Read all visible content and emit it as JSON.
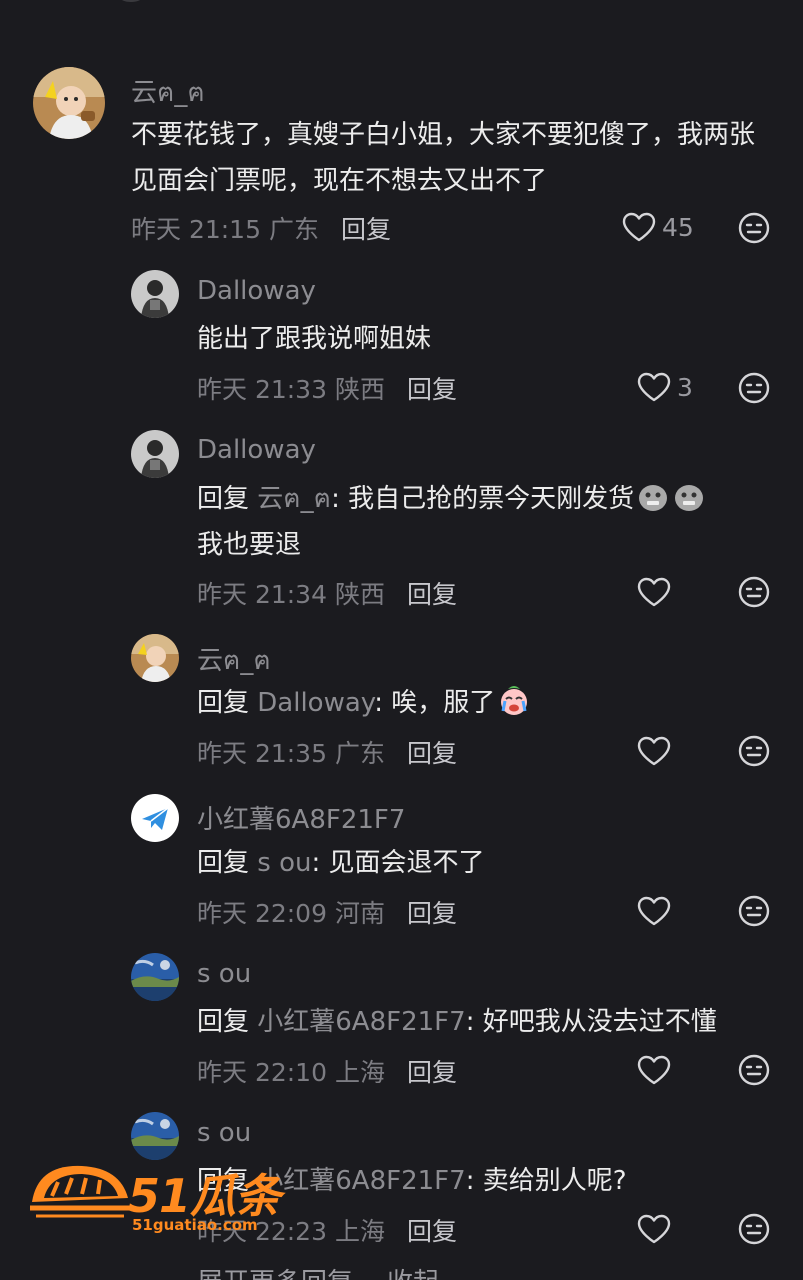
{
  "comments": [
    {
      "username": "云ฅ_ฅ",
      "text": "不要花钱了，真嫂子白小姐，大家不要犯傻了，我两张见面会门票呢，现在不想去又出不了",
      "time": "昨天 21:15",
      "location": "广东",
      "reply_label": "回复",
      "likes": "45"
    },
    {
      "username": "Dalloway",
      "text": "能出了跟我说啊姐妹",
      "time": "昨天 21:33",
      "location": "陕西",
      "reply_label": "回复",
      "likes": "3"
    },
    {
      "username": "Dalloway",
      "reply_prefix": "回复 ",
      "reply_target": "云ฅ_ฅ",
      "text": ": 我自己抢的票今天刚发货",
      "text2": "我也要退",
      "time": "昨天 21:34",
      "location": "陕西",
      "reply_label": "回复",
      "likes": ""
    },
    {
      "username": "云ฅ_ฅ",
      "reply_prefix": "回复 ",
      "reply_target": "Dalloway",
      "text": ": 唉，服了",
      "time": "昨天 21:35",
      "location": "广东",
      "reply_label": "回复",
      "likes": ""
    },
    {
      "username": "小红薯6A8F21F7",
      "reply_prefix": "回复 ",
      "reply_target": "s ou",
      "text": ": 见面会退不了",
      "time": "昨天 22:09",
      "location": "河南",
      "reply_label": "回复",
      "likes": ""
    },
    {
      "username": "s ou",
      "reply_prefix": "回复 ",
      "reply_target": "小红薯6A8F21F7",
      "text": ": 好吧我从没去过不懂",
      "time": "昨天 22:10",
      "location": "上海",
      "reply_label": "回复",
      "likes": ""
    },
    {
      "username": "s ou",
      "reply_prefix": "回复 ",
      "reply_target": "小红薯6A8F21F7",
      "text": ": 卖给别人呢?",
      "time": "昨天 22:23",
      "location": "上海",
      "reply_label": "回复",
      "likes": ""
    }
  ],
  "footer": {
    "expand_more": "展开更多回复",
    "collapse": "收起"
  },
  "watermark": {
    "brand": "51瓜条",
    "url": "51guatiao.com"
  },
  "icons": {
    "like": "heart-outline-icon",
    "emoji": "neutral-face-icon",
    "send": "paper-plane-icon"
  },
  "colors": {
    "background": "#1b1b1f",
    "text": "#ececec",
    "muted": "#8c8c91",
    "watermark": "#ff8a1f"
  }
}
